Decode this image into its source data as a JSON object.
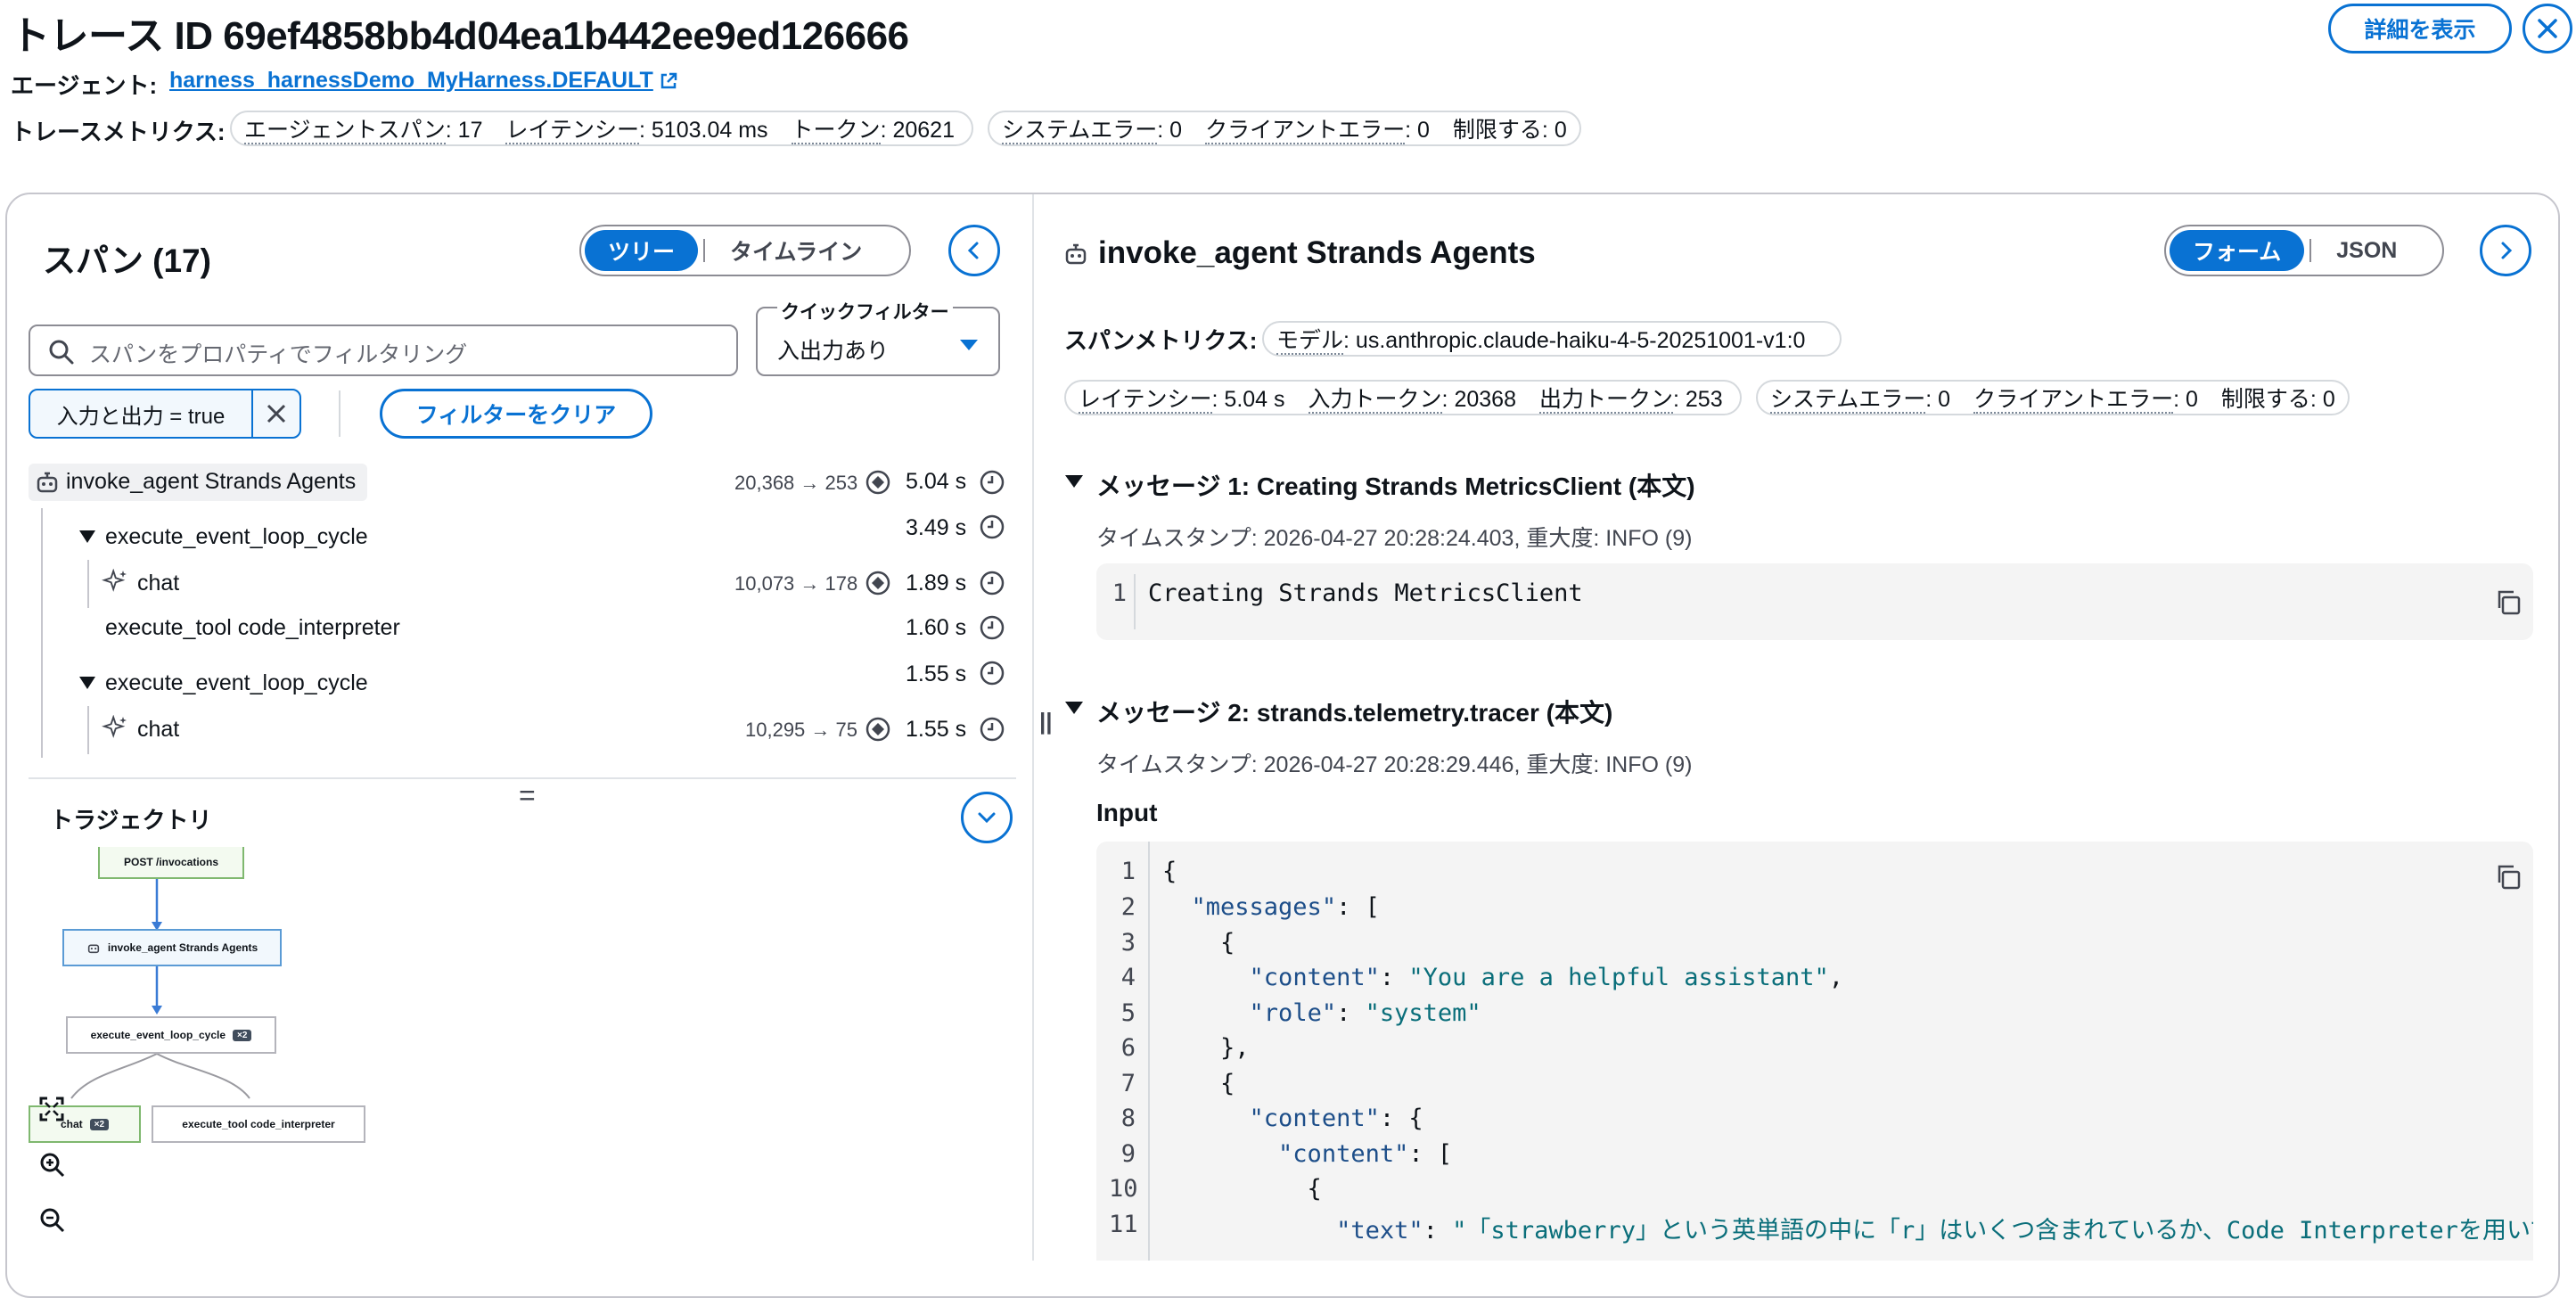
{
  "header": {
    "trace_title": "トレース ID 69ef4858bb4d04ea1b442ee9ed126666",
    "details_button": "詳細を表示",
    "agent_label": "エージェント:",
    "agent_link": "harness_harnessDemo_MyHarness.DEFAULT",
    "metrics_label": "トレースメトリクス:",
    "metrics_group1": [
      {
        "key": "エージェントスパン",
        "value": "17"
      },
      {
        "key": "レイテンシー",
        "value": "5103.04 ms"
      },
      {
        "key": "トークン",
        "value": "20621"
      }
    ],
    "metrics_group2": [
      {
        "key": "システムエラー",
        "value": "0"
      },
      {
        "key": "クライアントエラー",
        "value": "0"
      },
      {
        "key": "制限する",
        "value": "0"
      }
    ]
  },
  "left": {
    "title": "スパン (17)",
    "tab_tree": "ツリー",
    "tab_timeline": "タイムライン",
    "filter_placeholder": "スパンをプロパティでフィルタリング",
    "quick_filter_label": "クイックフィルター",
    "quick_filter_value": "入出力あり",
    "token_filter": "入力と出力 = true",
    "clear_filter": "フィルターをクリア",
    "spans": [
      {
        "name": "invoke_agent Strands Agents",
        "tokens": "20,368 → 253",
        "duration": "5.04 s"
      },
      {
        "name": "execute_event_loop_cycle",
        "tokens": "",
        "duration": "3.49 s"
      },
      {
        "name": "chat",
        "tokens": "10,073 → 178",
        "duration": "1.89 s"
      },
      {
        "name": "execute_tool code_interpreter",
        "tokens": "",
        "duration": "1.60 s"
      },
      {
        "name": "execute_event_loop_cycle",
        "tokens": "",
        "duration": "1.55 s"
      },
      {
        "name": "chat",
        "tokens": "10,295 → 75",
        "duration": "1.55 s"
      }
    ],
    "resize_handle": "=",
    "trajectory_title": "トラジェクトリ",
    "flow": {
      "node_post": "POST /invocations",
      "node_agent": "invoke_agent Strands Agents",
      "node_loop": "execute_event_loop_cycle",
      "node_loop_badge": "×2",
      "node_chat": "chat",
      "node_chat_badge": "×2",
      "node_tool": "execute_tool code_interpreter"
    }
  },
  "right": {
    "title": "invoke_agent Strands Agents",
    "tab_form": "フォーム",
    "tab_json": "JSON",
    "span_metrics_label": "スパンメトリクス:",
    "model_key": "モデル",
    "model_value": "us.anthropic.claude-haiku-4-5-20251001-v1:0",
    "metrics_group1": [
      {
        "key": "レイテンシー",
        "value": "5.04 s"
      },
      {
        "key": "入力トークン",
        "value": "20368"
      },
      {
        "key": "出力トークン",
        "value": "253"
      }
    ],
    "metrics_group2": [
      {
        "key": "システムエラー",
        "value": "0"
      },
      {
        "key": "クライアントエラー",
        "value": "0"
      },
      {
        "key": "制限する",
        "value": "0"
      }
    ],
    "message1": {
      "title": "メッセージ 1: Creating Strands MetricsClient (本文)",
      "meta": "タイムスタンプ: 2026-04-27 20:28:24.403, 重大度: INFO (9)",
      "lines": [
        "Creating Strands MetricsClient"
      ]
    },
    "message2": {
      "title": "メッセージ 2: strands.telemetry.tracer (本文)",
      "meta": "タイムスタンプ: 2026-04-27 20:28:29.446, 重大度: INFO (9)",
      "input_label": "Input",
      "line_numbers": [
        "1",
        "2",
        "3",
        "4",
        "5",
        "6",
        "7",
        "8",
        "9",
        "10",
        "11"
      ]
    }
  },
  "colors": {
    "accent": "#0972d3",
    "border": "#c6c6cd",
    "code_bg": "#f4f4f4"
  }
}
